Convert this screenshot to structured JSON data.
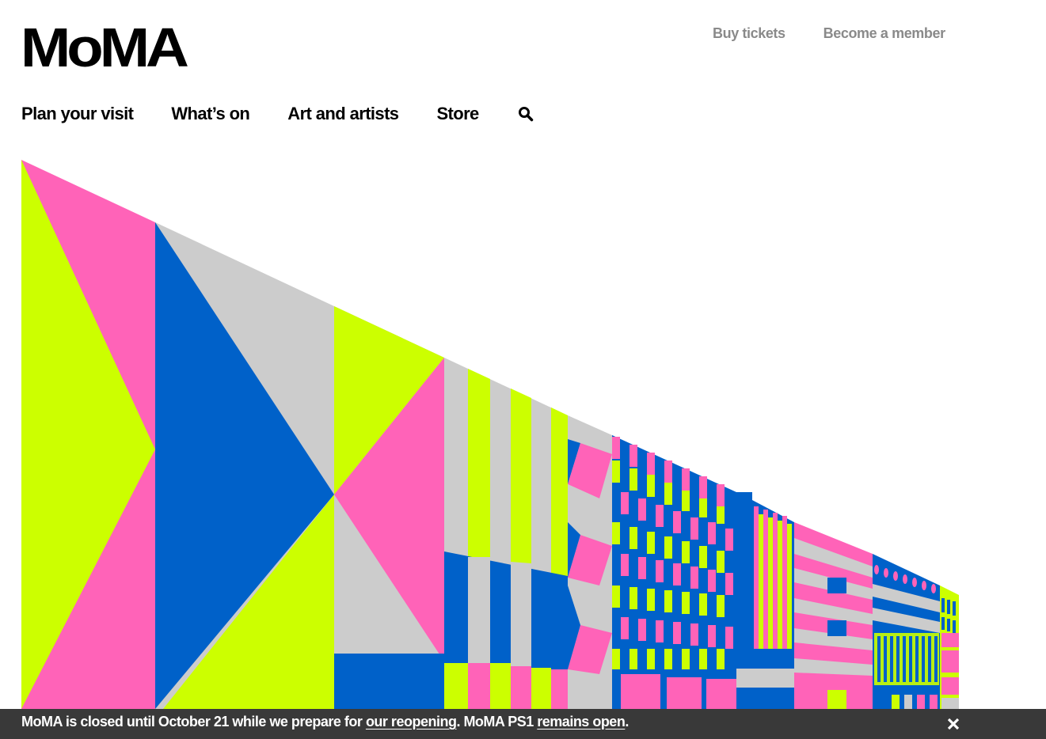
{
  "header": {
    "logo_text": "MoMA",
    "top_links": {
      "buy_tickets": "Buy tickets",
      "become_member": "Become a member"
    }
  },
  "nav": {
    "plan_visit": "Plan your visit",
    "whats_on": "What’s on",
    "art_artists": "Art and artists",
    "store": "Store",
    "search_icon": "search-icon"
  },
  "hero": {
    "palette": {
      "lime": "#CCFF00",
      "pink": "#FF63B8",
      "blue": "#0061C9",
      "gray": "#CCCCCC"
    }
  },
  "banner": {
    "text_1": "MoMA is closed until October 21 while we prepare for ",
    "link_1": "our reopening",
    "text_2": ". MoMA PS1 ",
    "link_2": "remains open",
    "text_3": ".",
    "close_icon": "close-icon"
  },
  "colors": {
    "top_link_gray": "#8A8A8A",
    "banner_bg": "#181818"
  }
}
